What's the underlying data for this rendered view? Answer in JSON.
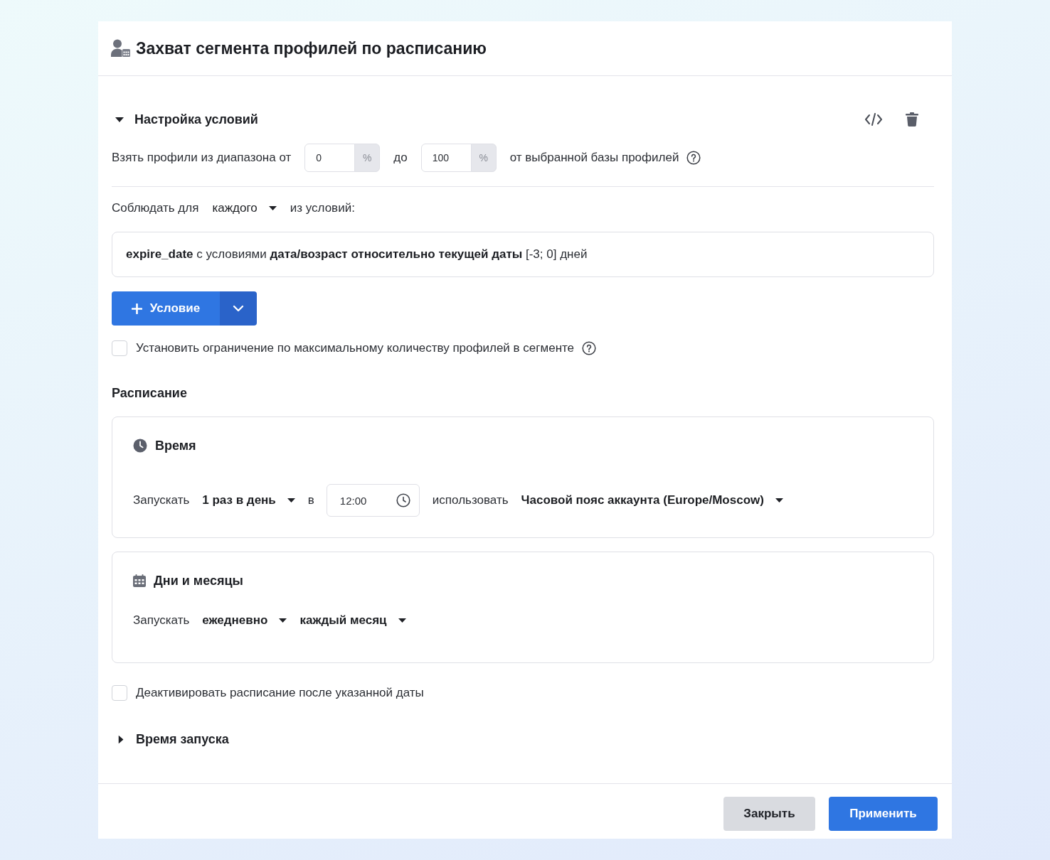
{
  "dialog": {
    "title": "Захват сегмента профилей по расписанию"
  },
  "conditions": {
    "title": "Настройка условий",
    "expanded": true,
    "range": {
      "label": "Взять профили из диапазона от",
      "from": {
        "value": "0",
        "unit": "%"
      },
      "to_label": "до",
      "to": {
        "value": "100",
        "unit": "%"
      },
      "suffix": "от выбранной базы профилей"
    },
    "match": {
      "label": "Соблюдать для",
      "mode": "каждого",
      "suffix": "из условий:"
    },
    "items": [
      {
        "text": "**expire_date** с условиями **дата/возраст относительно текущей даты** [-3; 0] дней"
      }
    ],
    "add_button": {
      "label": "Условие"
    },
    "limit": {
      "label": "Установить ограничение по максимальному количеству профилей в сегменте",
      "checked": false
    }
  },
  "schedule": {
    "title": "Расписание",
    "cards": [
      {
        "kind": "time",
        "title": "Время",
        "row": [
          {
            "kind": "label",
            "text": "Запускать"
          },
          {
            "kind": "select",
            "text": "1 раз в день"
          },
          {
            "kind": "label",
            "text": "в"
          },
          {
            "kind": "time",
            "text": "12:00"
          },
          {
            "kind": "label",
            "text": "использовать"
          },
          {
            "kind": "select",
            "text": "Часовой пояс аккаунта (Europe/Moscow)"
          }
        ]
      },
      {
        "kind": "days",
        "title": "Дни и месяцы",
        "row": [
          {
            "kind": "label",
            "text": "Запускать"
          },
          {
            "kind": "select",
            "text": "ежедневно"
          },
          {
            "kind": "select",
            "text": "каждый месяц"
          }
        ]
      }
    ],
    "deactivate": {
      "label": "Деактивировать расписание после указанной даты",
      "checked": false
    },
    "launch_time": {
      "title": "Время запуска",
      "expanded": false
    }
  },
  "footer": {
    "buttons": [
      {
        "label": "Закрыть",
        "kind": "secondary"
      },
      {
        "label": "Применить",
        "kind": "primary"
      }
    ]
  }
}
